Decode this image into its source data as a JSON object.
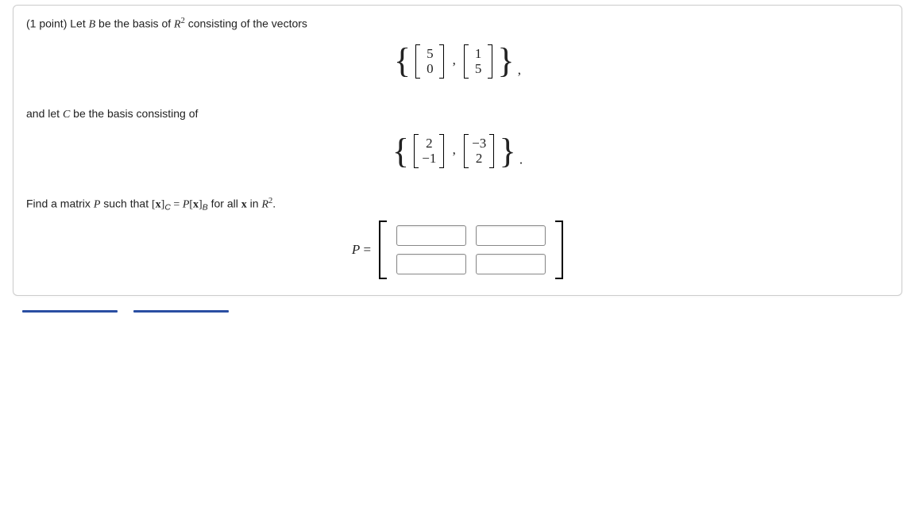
{
  "points_label": "(1 point)",
  "line1_pre": " Let ",
  "B": "B",
  "line1_mid": " be the basis of  ",
  "Rsym": "R",
  "Rexp": "2",
  "line1_post": " consisting of the vectors",
  "basis_B": {
    "v1": [
      "5",
      "0"
    ],
    "v2": [
      "1",
      "5"
    ]
  },
  "trailing_comma": ",",
  "line2_pre": "and let ",
  "C": "C",
  "line2_post": " be the basis consisting of",
  "basis_C": {
    "v1": [
      " 2",
      "−1"
    ],
    "v2": [
      "−3",
      " 2"
    ]
  },
  "trailing_period": ".",
  "line3_a": "Find a matrix ",
  "P": "P",
  "line3_b": " such that ",
  "xC_open": "[",
  "x_bold": "x",
  "xC_close": "]",
  "sub_C": "C",
  "equals": " = ",
  "sub_B": "B",
  "line3_c": " for all ",
  "line3_d": " in  ",
  "period": ".",
  "P_equals": "P =",
  "matrix_values": {
    "a11": "",
    "a12": "",
    "a21": "",
    "a22": ""
  }
}
